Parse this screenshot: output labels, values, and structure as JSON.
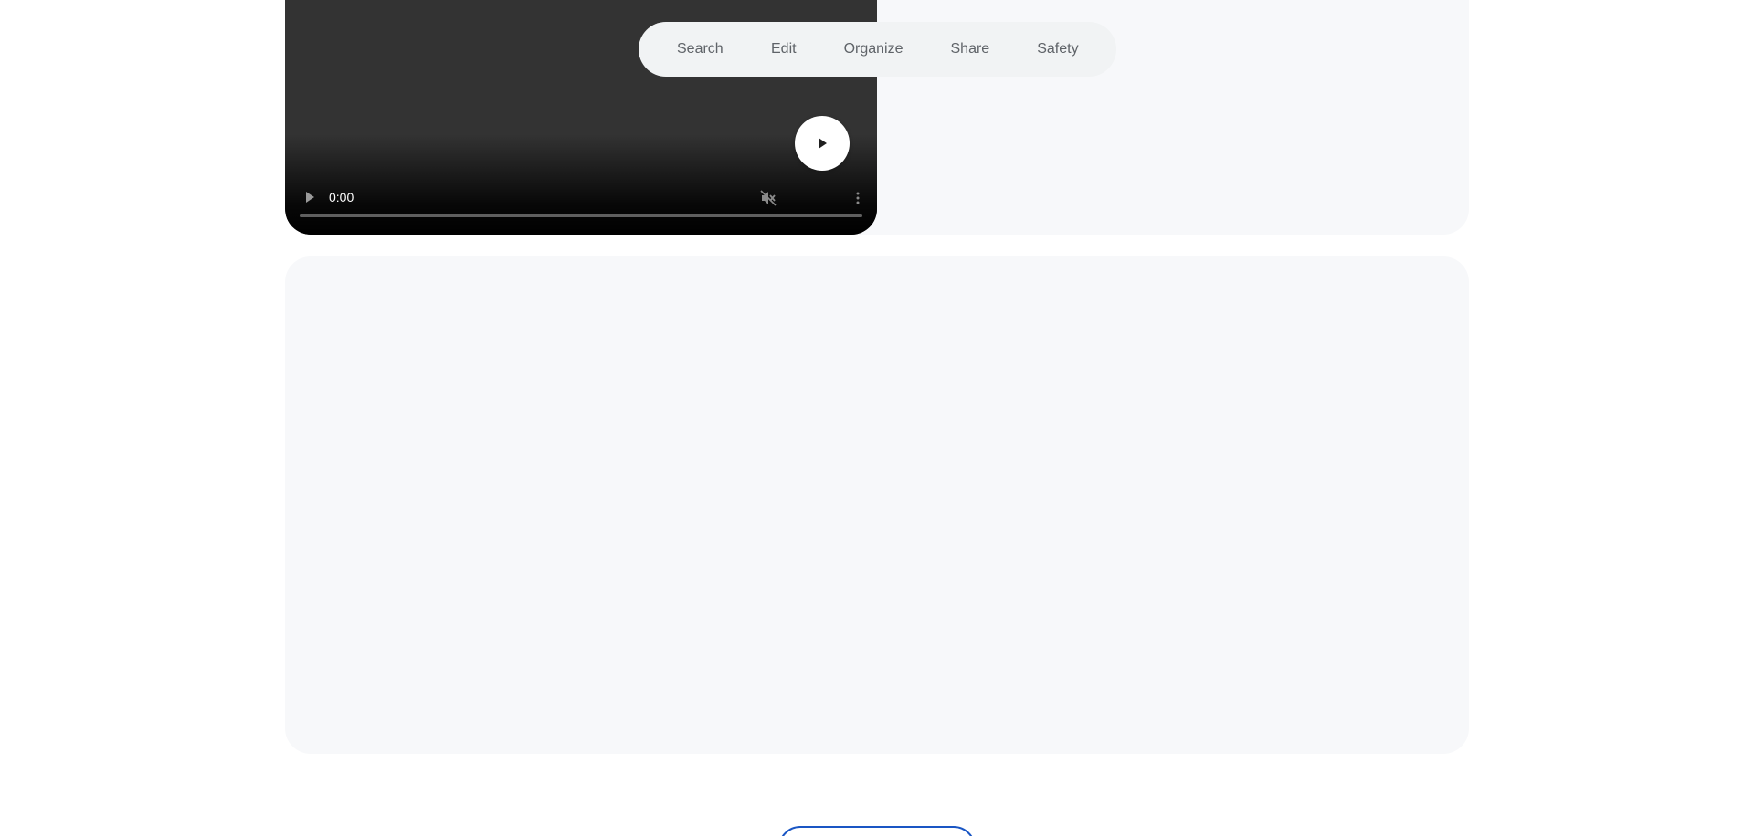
{
  "nav": {
    "items": [
      {
        "label": "Search"
      },
      {
        "label": "Edit"
      },
      {
        "label": "Organize"
      },
      {
        "label": "Share"
      },
      {
        "label": "Safety"
      }
    ]
  },
  "video": {
    "current_time": "0:00",
    "progress_fraction": 0,
    "play_icon": "play-icon",
    "mute_icon": "muted-speaker-icon",
    "more_icon": "more-vertical-icon",
    "big_play_icon": "play-icon"
  },
  "colors": {
    "card_background": "#f7f8fa",
    "nav_background": "#f1f3f4",
    "nav_text": "#5f6368",
    "video_background": "#333333",
    "button_accent": "#1a56c4"
  },
  "footer": {
    "button_label": ""
  }
}
